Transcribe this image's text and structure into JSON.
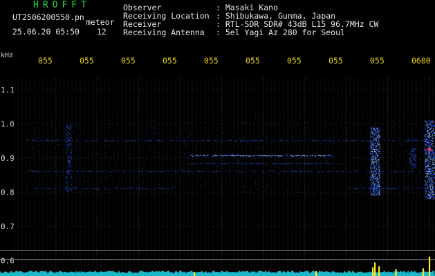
{
  "header": {
    "brand": "HROFFT",
    "filename": "UT2506200550.pn",
    "meteor_label": "meteor",
    "datetime": "25.06.20 05:50",
    "meteor_count": "12",
    "info": [
      {
        "label": "Observer",
        "value": ": Masaki Kano"
      },
      {
        "label": "Receiving Location",
        "value": ": Shibukawa, Gunma, Japan"
      },
      {
        "label": "Receiver",
        "value": ": RTL-SDR SDR# 43dB L15 96.7MHz CW"
      },
      {
        "label": "Receiving Antenna",
        "value": ": 5el Yagi Az 280 for Seoul"
      }
    ]
  },
  "colors": {
    "background": "#000000",
    "grid": "#4a4a4a",
    "time_label": "#e8d020",
    "axis_label": "#d8d8d8",
    "signal": "#2a5cff",
    "signal_bright": "#9ad0ff",
    "meteor_head": "#ff3060",
    "noise_floor": "#19b8c8",
    "spike": "#ffee20"
  },
  "chart_data": {
    "type": "heatmap",
    "ylabel": "kHz",
    "y_ticks": [
      "1.1",
      "1.0",
      "0.9",
      "0.8",
      "0.7",
      "0.6"
    ],
    "ylim": [
      0.59,
      1.15
    ],
    "x_ticks": [
      "055",
      "055",
      "055",
      "055",
      "055",
      "055",
      "055",
      "055",
      "055",
      "0600"
    ],
    "grid": true,
    "traces": [
      {
        "kind": "horizontal",
        "freq": 0.908,
        "t_start": 0.42,
        "t_end": 0.76,
        "strength": 0.9
      },
      {
        "kind": "horizontal",
        "freq": 0.885,
        "t_start": 0.42,
        "t_end": 0.78,
        "strength": 0.55
      },
      {
        "kind": "horizontal",
        "freq": 0.952,
        "t_start": 0.03,
        "t_end": 1.0,
        "strength": 0.35
      },
      {
        "kind": "horizontal",
        "freq": 0.862,
        "t_start": 0.03,
        "t_end": 1.0,
        "strength": 0.25
      },
      {
        "kind": "horizontal",
        "freq": 0.812,
        "t_start": 0.03,
        "t_end": 0.38,
        "strength": 0.3
      },
      {
        "kind": "horizontal",
        "freq": 0.812,
        "t_start": 0.8,
        "t_end": 0.99,
        "strength": 0.4
      },
      {
        "kind": "vertical",
        "t": 0.86,
        "f_low": 0.79,
        "f_high": 0.99,
        "strength": 1.0
      },
      {
        "kind": "vertical",
        "t": 0.99,
        "f_low": 0.78,
        "f_high": 1.01,
        "strength": 1.0
      },
      {
        "kind": "vertical",
        "t": 0.13,
        "f_low": 0.8,
        "f_high": 1.0,
        "strength": 0.4
      },
      {
        "kind": "vertical",
        "t": 0.95,
        "f_low": 0.87,
        "f_high": 0.93,
        "strength": 0.5
      }
    ],
    "meteor_heads": [
      {
        "t": 0.995,
        "freq": 0.925
      }
    ],
    "noise_floor_level": 0.62,
    "spikes": [
      {
        "t": 0.86,
        "height": 0.7
      },
      {
        "t": 0.87,
        "height": 0.5
      },
      {
        "t": 0.855,
        "height": 0.45
      },
      {
        "t": 0.91,
        "height": 0.35
      },
      {
        "t": 0.99,
        "height": 1.0
      },
      {
        "t": 0.975,
        "height": 0.4
      },
      {
        "t": 0.72,
        "height": 0.25
      },
      {
        "t": 0.43,
        "height": 0.2
      }
    ]
  }
}
